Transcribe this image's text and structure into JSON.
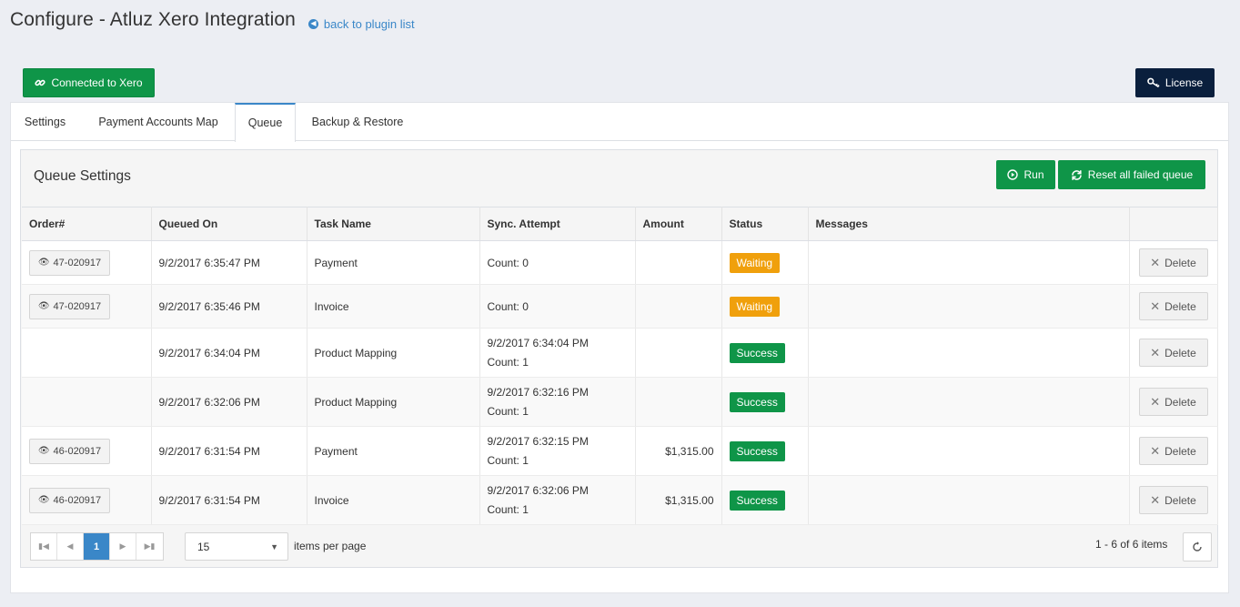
{
  "header": {
    "title": "Configure - Atluz Xero Integration",
    "back_link": "back to plugin list"
  },
  "toolbar": {
    "connected_label": "Connected to Xero",
    "license_label": "License"
  },
  "tabs": [
    {
      "label": "Settings",
      "active": false
    },
    {
      "label": "Payment Accounts Map",
      "active": false
    },
    {
      "label": "Queue",
      "active": true
    },
    {
      "label": "Backup & Restore",
      "active": false
    }
  ],
  "queue": {
    "title": "Queue Settings",
    "run_label": "Run",
    "reset_label": "Reset all failed queue",
    "columns": [
      "Order#",
      "Queued On",
      "Task Name",
      "Sync. Attempt",
      "Amount",
      "Status",
      "Messages",
      ""
    ],
    "rows": [
      {
        "order": "47-020917",
        "queued_on": "9/2/2017 6:35:47 PM",
        "task": "Payment",
        "attempt_time": "",
        "attempt_count": "Count: 0",
        "amount": "",
        "status": "Waiting",
        "messages": "",
        "delete": "Delete"
      },
      {
        "order": "47-020917",
        "queued_on": "9/2/2017 6:35:46 PM",
        "task": "Invoice",
        "attempt_time": "",
        "attempt_count": "Count: 0",
        "amount": "",
        "status": "Waiting",
        "messages": "",
        "delete": "Delete"
      },
      {
        "order": "",
        "queued_on": "9/2/2017 6:34:04 PM",
        "task": "Product Mapping",
        "attempt_time": "9/2/2017 6:34:04 PM",
        "attempt_count": "Count: 1",
        "amount": "",
        "status": "Success",
        "messages": "",
        "delete": "Delete"
      },
      {
        "order": "",
        "queued_on": "9/2/2017 6:32:06 PM",
        "task": "Product Mapping",
        "attempt_time": "9/2/2017 6:32:16 PM",
        "attempt_count": "Count: 1",
        "amount": "",
        "status": "Success",
        "messages": "",
        "delete": "Delete"
      },
      {
        "order": "46-020917",
        "queued_on": "9/2/2017 6:31:54 PM",
        "task": "Payment",
        "attempt_time": "9/2/2017 6:32:15 PM",
        "attempt_count": "Count: 1",
        "amount": "$1,315.00",
        "status": "Success",
        "messages": "",
        "delete": "Delete"
      },
      {
        "order": "46-020917",
        "queued_on": "9/2/2017 6:31:54 PM",
        "task": "Invoice",
        "attempt_time": "9/2/2017 6:32:06 PM",
        "attempt_count": "Count: 1",
        "amount": "$1,315.00",
        "status": "Success",
        "messages": "",
        "delete": "Delete"
      }
    ]
  },
  "pagination": {
    "current_page": "1",
    "page_size": "15",
    "items_per_page_label": "items per page",
    "item_count": "1 - 6 of 6 items"
  },
  "colors": {
    "accent": "#3a87c8",
    "success": "#0f9548",
    "waiting": "#f0a00c",
    "license": "#0a1f3d"
  },
  "icons": {
    "back": "arrow-left-circle-icon",
    "connected": "link-icon",
    "license": "key-icon",
    "run": "play-circle-icon",
    "reset": "refresh-icon",
    "order": "eye-icon",
    "delete": "close-icon",
    "pager": [
      "first-page-icon",
      "prev-page-icon",
      "next-page-icon",
      "last-page-icon"
    ],
    "refresh": "refresh-icon"
  }
}
